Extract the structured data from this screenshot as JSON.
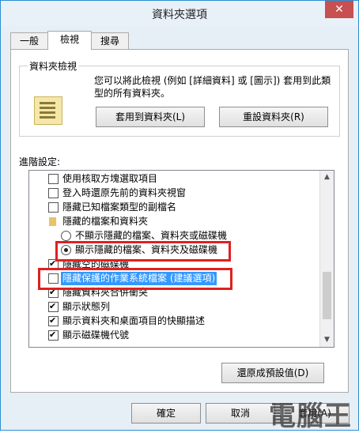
{
  "window": {
    "title": "資料夾選項",
    "close_label": "✕"
  },
  "tabs": [
    {
      "label": "一般",
      "active": false
    },
    {
      "label": "檢視",
      "active": true
    },
    {
      "label": "搜尋",
      "active": false
    }
  ],
  "folder_view": {
    "group_label": "資料夾檢視",
    "description": "您可以將此檢視 (例如 [詳細資料] 或 [圖示]) 套用到此類型的所有資料夾。",
    "apply_button": "套用到資料夾(L)",
    "reset_button": "重設資料夾(R)"
  },
  "advanced": {
    "label": "進階設定:",
    "items": [
      {
        "type": "checkbox",
        "label": "使用核取方塊選取項目",
        "checked": false
      },
      {
        "type": "checkbox",
        "label": "登入時還原先前的資料夾視窗",
        "checked": false
      },
      {
        "type": "checkbox",
        "label": "隱藏已知檔案類型的副檔名",
        "checked": false
      },
      {
        "type": "folder",
        "label": "隱藏的檔案和資料夾"
      },
      {
        "type": "radio",
        "label": "不顯示隱藏的檔案、資料夾或磁碟機",
        "selected": false
      },
      {
        "type": "radio",
        "label": "顯示隱藏的檔案、資料夾及磁碟機",
        "selected": true
      },
      {
        "type": "checkbox",
        "label": "隱藏空的磁碟機",
        "checked": true
      },
      {
        "type": "checkbox",
        "label": "隱藏保護的作業系統檔案 (建議選項)",
        "checked": false,
        "highlighted": true
      },
      {
        "type": "checkbox",
        "label": "隱藏資料夾合併衝突",
        "checked": true
      },
      {
        "type": "checkbox",
        "label": "顯示狀態列",
        "checked": true
      },
      {
        "type": "checkbox",
        "label": "顯示資料夾和桌面項目的快顯描述",
        "checked": true
      },
      {
        "type": "checkbox",
        "label": "顯示磁碟機代號",
        "checked": true
      }
    ],
    "restore_defaults_button": "還原成預設值(D)"
  },
  "footer": {
    "ok_button": "確定",
    "cancel_button": "取消",
    "apply_button": "套用(A)"
  },
  "watermark": "電腦王",
  "colors": {
    "selection": "#3399ff",
    "annotation": "#e02020",
    "close": "#c75050"
  }
}
